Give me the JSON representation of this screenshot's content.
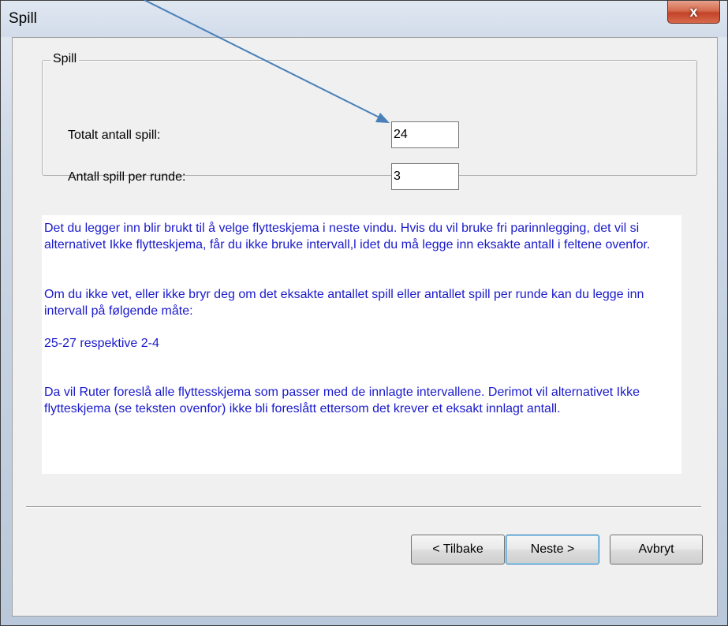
{
  "window": {
    "title": "Spill",
    "close_glyph": "x"
  },
  "group": {
    "legend": "Spill",
    "fields": [
      {
        "label": "Totalt antall spill:",
        "value": "24"
      },
      {
        "label": "Antall spill per runde:",
        "value": "3"
      }
    ]
  },
  "info": {
    "paragraphs": [
      "Det du legger inn blir brukt til å velge flytteskjema i neste vindu. Hvis du vil bruke fri parinnlegging, det vil si alternativet Ikke flytteskjema, får du ikke bruke intervall,l idet du må legge inn eksakte antall i feltene ovenfor.",
      "Om du ikke vet, eller ikke bryr deg om det eksakte antallet spill eller antallet spill per runde kan du legge inn intervall på følgende måte:",
      "25-27 respektive 2-4",
      "Da vil Ruter foreslå alle flyttesskjema som passer med de innlagte intervallene. Derimot vil alternativet Ikke flytteskjema (se teksten ovenfor) ikke bli foreslått ettersom det krever et eksakt innlagt antall."
    ]
  },
  "buttons": {
    "back": "< Tilbake",
    "next": "Neste >",
    "cancel": "Avbryt"
  },
  "colors": {
    "info_text": "#1a1acc",
    "arrow": "#4a7fb8",
    "close_button": "#c2432a"
  }
}
